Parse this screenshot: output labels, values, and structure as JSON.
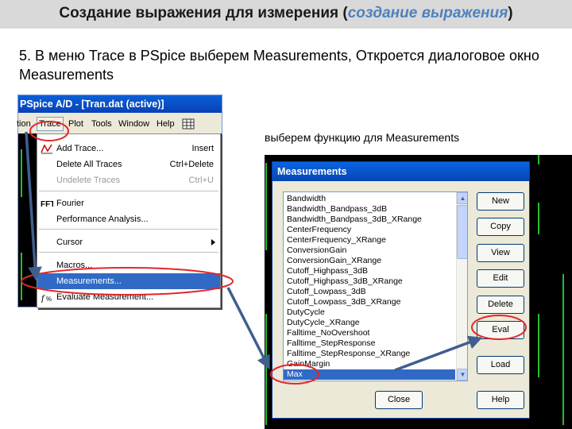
{
  "slide": {
    "title_main": "Создание выражения для измерения (",
    "title_accent": "создание выражения",
    "title_end": ")",
    "instruction": "5.  В меню Trace в PSpice выберем Measurements, Откроется диалоговое окно Measurements",
    "caption": "выберем функцию для Measurements"
  },
  "pspice": {
    "window_title": "PSpice A/D  - [Tran.dat (active)]",
    "menubar": [
      "tion",
      "Trace",
      "Plot",
      "Tools",
      "Window",
      "Help"
    ],
    "menu_items": [
      {
        "label": "Add Trace...",
        "shortcut": "Insert",
        "icon": "add-trace-icon"
      },
      {
        "label": "Delete All Traces",
        "shortcut": "Ctrl+Delete"
      },
      {
        "label": "Undelete Traces",
        "shortcut": "Ctrl+U",
        "disabled": true
      },
      {
        "label": "Fourier",
        "icon": "fourier-icon"
      },
      {
        "label": "Performance Analysis..."
      },
      {
        "label": "Cursor",
        "submenu": true
      },
      {
        "label": "Macros..."
      },
      {
        "label": "Measurements...",
        "selected": true
      },
      {
        "label": "Evaluate Measurement...",
        "icon": "evaluate-measurement-icon"
      }
    ]
  },
  "dialog": {
    "title": "Measurements",
    "functions": [
      "Bandwidth",
      "Bandwidth_Bandpass_3dB",
      "Bandwidth_Bandpass_3dB_XRange",
      "CenterFrequency",
      "CenterFrequency_XRange",
      "ConversionGain",
      "ConversionGain_XRange",
      "Cutoff_Highpass_3dB",
      "Cutoff_Highpass_3dB_XRange",
      "Cutoff_Lowpass_3dB",
      "Cutoff_Lowpass_3dB_XRange",
      "DutyCycle",
      "DutyCycle_XRange",
      "Falltime_NoOvershoot",
      "Falltime_StepResponse",
      "Falltime_StepResponse_XRange",
      "GainMargin",
      "Max"
    ],
    "selected_function": "Max",
    "buttons": [
      "New",
      "Copy",
      "View",
      "Edit",
      "Delete",
      "Eval",
      "Load",
      "Help"
    ],
    "close_label": "Close"
  },
  "colors": {
    "title_accent": "#4f81bd",
    "highlight_ellipse": "#e3262b",
    "arrow": "#3f5f8f",
    "selection": "#316ac5",
    "plot_trace": "#22c02a"
  }
}
